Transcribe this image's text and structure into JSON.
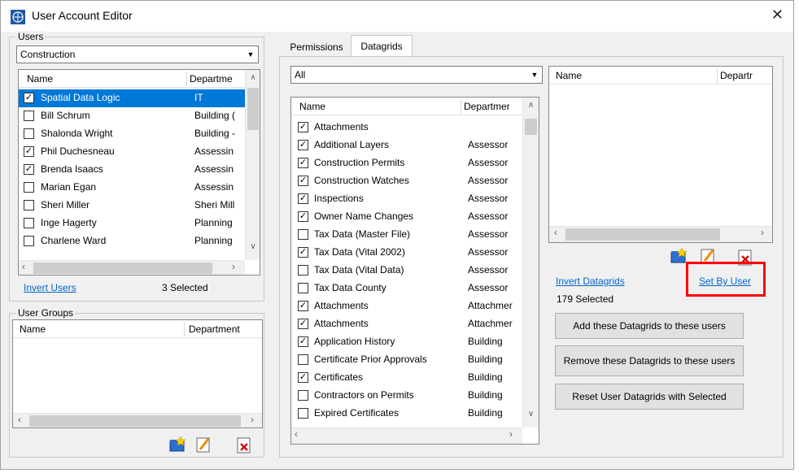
{
  "window": {
    "title": "User Account Editor",
    "close": "✕"
  },
  "users": {
    "legend": "Users",
    "dropdown_value": "Construction",
    "columns": [
      "Name",
      "Departme"
    ],
    "rows": [
      {
        "name": "Spatial  Data Logic",
        "dept": "IT",
        "checked": true,
        "selected": true
      },
      {
        "name": "Bill Schrum",
        "dept": "Building (",
        "checked": false
      },
      {
        "name": "Shalonda Wright",
        "dept": "Building -",
        "checked": false
      },
      {
        "name": "Phil Duchesneau",
        "dept": "Assessin",
        "checked": true
      },
      {
        "name": "Brenda Isaacs",
        "dept": "Assessin",
        "checked": true
      },
      {
        "name": "Marian Egan",
        "dept": "Assessin",
        "checked": false
      },
      {
        "name": "Sheri Miller",
        "dept": "Sheri Mill",
        "checked": false
      },
      {
        "name": "Inge Hagerty",
        "dept": "Planning",
        "checked": false
      },
      {
        "name": "Charlene Ward",
        "dept": "Planning",
        "checked": false
      }
    ],
    "invert_link": "Invert Users",
    "selected_count": "3 Selected"
  },
  "user_groups": {
    "legend": "User Groups",
    "columns": [
      "Name",
      "Department"
    ]
  },
  "tabs": [
    "Permissions",
    "Datagrids"
  ],
  "datagrids": {
    "filter_value": "All",
    "columns": [
      "Name",
      "Departmer"
    ],
    "rows": [
      {
        "name": "Attachments",
        "dept": "",
        "checked": true
      },
      {
        "name": "Additional Layers",
        "dept": "Assessor",
        "checked": true
      },
      {
        "name": "Construction Permits",
        "dept": "Assessor",
        "checked": true
      },
      {
        "name": "Construction Watches",
        "dept": "Assessor",
        "checked": true
      },
      {
        "name": "Inspections",
        "dept": "Assessor",
        "checked": true
      },
      {
        "name": "Owner Name Changes",
        "dept": "Assessor",
        "checked": true
      },
      {
        "name": "Tax Data (Master File)",
        "dept": "Assessor",
        "checked": false
      },
      {
        "name": "Tax Data (Vital 2002)",
        "dept": "Assessor",
        "checked": true
      },
      {
        "name": "Tax Data (Vital Data)",
        "dept": "Assessor",
        "checked": false
      },
      {
        "name": "Tax Data County",
        "dept": "Assessor",
        "checked": false
      },
      {
        "name": "Attachments",
        "dept": "Attachmer",
        "checked": true
      },
      {
        "name": "Attachments",
        "dept": "Attachmer",
        "checked": true
      },
      {
        "name": "Application History",
        "dept": "Building",
        "checked": true
      },
      {
        "name": "Certificate Prior Approvals",
        "dept": "Building",
        "checked": false
      },
      {
        "name": "Certificates",
        "dept": "Building",
        "checked": true
      },
      {
        "name": "Contractors on Permits",
        "dept": "Building",
        "checked": false
      },
      {
        "name": "Expired Certificates",
        "dept": "Building",
        "checked": false
      }
    ],
    "user_columns": [
      "Name",
      "Departr"
    ],
    "invert_link": "Invert Datagrids",
    "set_by_user_link": "Set By User",
    "selected_count": "179 Selected",
    "buttons": {
      "add": "Add these Datagrids to these users",
      "remove": "Remove these Datagrids to these users",
      "reset": "Reset User Datagrids with Selected"
    }
  },
  "colors": {
    "selection": "#0078d7",
    "link": "#0066cc",
    "highlight": "#ff0000"
  }
}
